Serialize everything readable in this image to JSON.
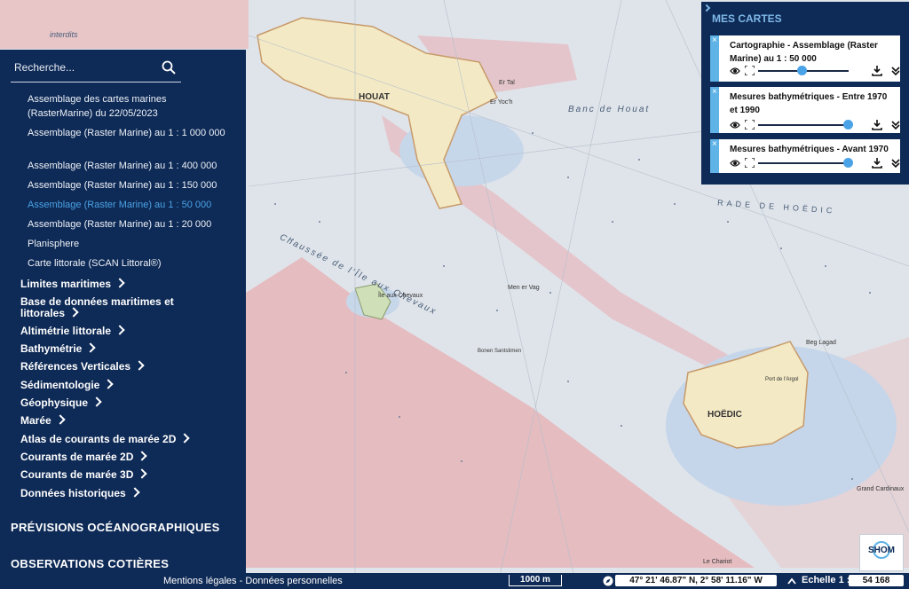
{
  "colors": {
    "panel_bg": "#0e2a56",
    "accent": "#4aa3e6",
    "sea": "#dfe4ea",
    "land": "#f3e9c4",
    "zone_pink": "#e8b6b6",
    "shallow": "#bcd3ea"
  },
  "search": {
    "placeholder": "Recherche..."
  },
  "sublist": [
    {
      "label": "Assemblage des cartes marines (RasterMarine) du 22/05/2023",
      "active": false
    },
    {
      "label": "Assemblage (Raster Marine) au 1 : 1 000 000",
      "active": false
    },
    {
      "label": "Assemblage (Raster Marine) au 1 : 400 000",
      "active": false
    },
    {
      "label": "Assemblage (Raster Marine) au 1 : 150 000",
      "active": false
    },
    {
      "label": "Assemblage (Raster Marine) au 1 : 50 000",
      "active": true
    },
    {
      "label": "Assemblage (Raster Marine) au 1 : 20 000",
      "active": false
    },
    {
      "label": "Planisphere",
      "active": false
    },
    {
      "label": "Carte littorale (SCAN Littoral®)",
      "active": false
    }
  ],
  "categories": [
    "Limites maritimes",
    "Base de données maritimes et littorales",
    "Altimétrie littorale",
    "Bathymétrie",
    "Références Verticales",
    "Sédimentologie",
    "Géophysique",
    "Marée",
    "Atlas de courants de marée 2D",
    "Courants de marée 2D",
    "Courants de marée 3D",
    "Données historiques"
  ],
  "sections": [
    "PRÉVISIONS OCÉANOGRAPHIQUES",
    "OBSERVATIONS COTIÈRES"
  ],
  "my_maps": {
    "title": "MES CARTES",
    "layers": [
      {
        "name": "Cartographie - Assemblage (Raster Marine) au 1 : 50 000",
        "opacity": 0.48
      },
      {
        "name": "Mesures bathymétriques - Entre 1970 et 1990",
        "opacity": 1.0
      },
      {
        "name": "Mesures bathymétriques - Avant 1970",
        "opacity": 1.0
      }
    ],
    "close_symbol": "×"
  },
  "map_labels": {
    "houat": "HOUAT",
    "banc_houat": "Banc de Houat",
    "hoedic": "HOËDIC",
    "chaussee": "Chaussée de l'Île aux Chevaux",
    "rade": "RADE DE HOËDIC",
    "ile_chevaux": "Île aux Chevaux",
    "grand_cardinaux": "Grand Cardinaux",
    "port_argol": "Port de l'Argol",
    "er_tal": "Er Tal",
    "er_yoch": "Er Yoc'h",
    "men_er_vag": "Men er Vag",
    "bonen_santstimen": "Bonen Santstimen",
    "le_chariot": "Le Chariot",
    "beg_lagad": "Beg Lagad",
    "interdits": "interdits"
  },
  "bottom": {
    "legal": "Mentions légales - Données personnelles",
    "scale_bar": "1000 m",
    "coordinates": "47° 21' 46.87\" N, 2° 58' 11.16\" W",
    "scale_label": "Echelle 1 :",
    "scale_value": "54 168"
  },
  "logo": {
    "text": "SHOM"
  },
  "icons": [
    "search-icon",
    "chevron-right-icon",
    "close-icon",
    "eye-icon",
    "fullscreen-icon",
    "download-icon",
    "double-chevron-down-icon",
    "compass-icon",
    "chevron-up-icon"
  ]
}
